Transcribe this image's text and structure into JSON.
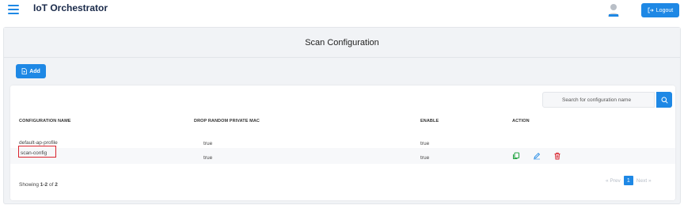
{
  "app": {
    "title": "IoT Orchestrator"
  },
  "header": {
    "logout_label": "Logout",
    "menu_icon": "hamburger-menu-icon",
    "avatar_icon": "user-avatar-icon"
  },
  "page": {
    "title": "Scan Configuration"
  },
  "toolbar": {
    "add_label": "Add"
  },
  "search": {
    "placeholder": "Search for configuration name"
  },
  "table": {
    "columns": [
      "CONFIGURATION NAME",
      "DROP RANDOM PRIVATE MAC",
      "ENABLE",
      "ACTION"
    ],
    "rows": [
      {
        "name": "default-ap-profile",
        "drop_mac": "true",
        "enable": "true"
      },
      {
        "name": "scan-config",
        "drop_mac": "true",
        "enable": "true",
        "actions": [
          "copy-icon",
          "edit-icon",
          "delete-icon"
        ]
      }
    ]
  },
  "footer": {
    "showing_prefix": "Showing ",
    "range": "1-2",
    "of": " of ",
    "total": "2"
  },
  "pagination": {
    "prev": "« Prev",
    "current": "1",
    "next": "Next »"
  },
  "colors": {
    "accent": "#1e88e5",
    "copy": "#2ca84a",
    "edit": "#1e88e5",
    "delete": "#d9232d",
    "highlight": "#d9232d"
  }
}
